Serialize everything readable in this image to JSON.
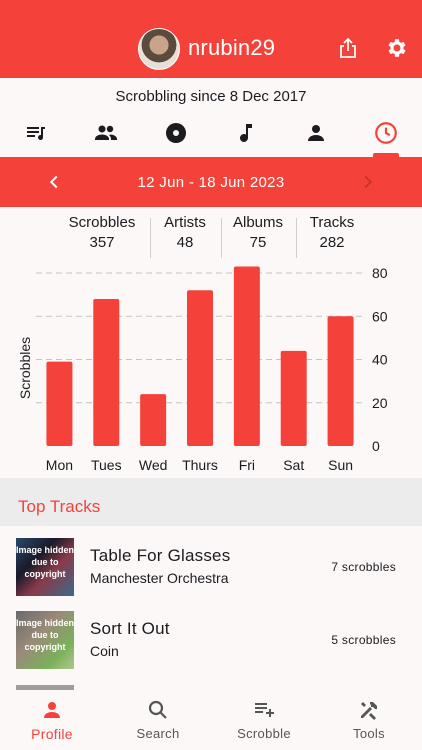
{
  "header": {
    "username": "nrubin29",
    "avatar_icon": "user-avatar",
    "share_icon": "share-icon",
    "settings_icon": "gear-icon",
    "color": "#f4423b"
  },
  "profile": {
    "since": "Scrobbling since 8 Dec 2017"
  },
  "tabs": [
    {
      "icon": "playlist-icon",
      "active": false
    },
    {
      "icon": "friends-icon",
      "active": false
    },
    {
      "icon": "album-icon",
      "active": false
    },
    {
      "icon": "music-note-icon",
      "active": false
    },
    {
      "icon": "person-icon",
      "active": false
    },
    {
      "icon": "clock-icon",
      "active": true
    }
  ],
  "period": {
    "label": "12 Jun - 18 Jun 2023",
    "prev_icon": "chevron-left-icon",
    "next_icon": "chevron-right-icon"
  },
  "stats": [
    {
      "label": "Scrobbles",
      "value": "357"
    },
    {
      "label": "Artists",
      "value": "48"
    },
    {
      "label": "Albums",
      "value": "75"
    },
    {
      "label": "Tracks",
      "value": "282"
    }
  ],
  "chart_data": {
    "type": "bar",
    "categories": [
      "Mon",
      "Tues",
      "Wed",
      "Thurs",
      "Fri",
      "Sat",
      "Sun"
    ],
    "values": [
      39,
      68,
      24,
      72,
      83,
      44,
      60
    ],
    "ylabel": "Scrobbles",
    "ylim": [
      0,
      80
    ],
    "yticks": [
      "0",
      "20",
      "40",
      "60",
      "80"
    ],
    "grid": true,
    "color": "#f4423b"
  },
  "top_tracks": {
    "title": "Top Tracks",
    "items": [
      {
        "title": "Table For Glasses",
        "artist": "Manchester Orchestra",
        "count": "7 scrobbles",
        "thumb_text": "Image hidden due to copyright"
      },
      {
        "title": "Sort It Out",
        "artist": "Coin",
        "count": "5 scrobbles",
        "thumb_text": "Image hidden due to copyright"
      }
    ]
  },
  "nav": [
    {
      "label": "Profile",
      "icon": "person-icon",
      "active": true
    },
    {
      "label": "Search",
      "icon": "search-icon",
      "active": false
    },
    {
      "label": "Scrobble",
      "icon": "playlist-add-icon",
      "active": false
    },
    {
      "label": "Tools",
      "icon": "tools-icon",
      "active": false
    }
  ]
}
